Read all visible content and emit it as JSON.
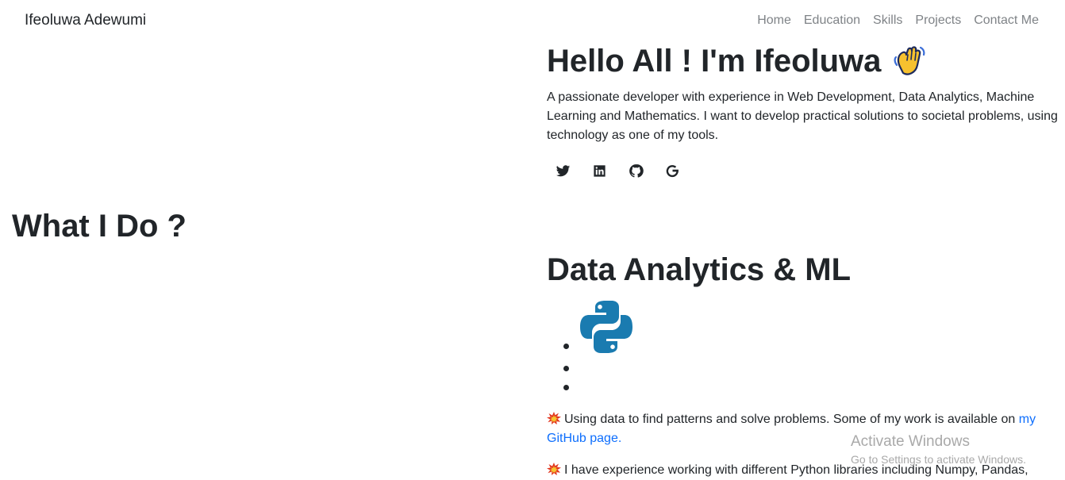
{
  "navbar": {
    "brand": "Ifeoluwa Adewumi",
    "links": [
      "Home",
      "Education",
      "Skills",
      "Projects",
      "Contact Me"
    ]
  },
  "hero": {
    "title": "Hello All ! I'm Ifeoluwa",
    "title_icon": "waving-hand-emoji",
    "description": "A passionate developer with experience in Web Development, Data Analytics, Machine Learning and Mathematics. I want to develop practical solutions to societal problems, using technology as one of my tools.",
    "socials": [
      "twitter-icon",
      "linkedin-icon",
      "github-icon",
      "google-icon"
    ]
  },
  "what_i_do": {
    "title": "What I Do ?"
  },
  "data_analytics": {
    "title": "Data Analytics & ML",
    "skill_icons": [
      "python-icon"
    ],
    "para1_text": "Using data to find patterns and solve problems. Some of my work is available on ",
    "para1_link": "my GitHub page.",
    "para2_text": "I have experience working with different Python libraries including Numpy, Pandas,",
    "bullet_icon": "collision-emoji"
  },
  "watermark": {
    "line1": "Activate Windows",
    "line2": "Go to Settings to activate Windows."
  },
  "colors": {
    "text": "#212529",
    "nav_link": "#7f8387",
    "link": "#0d6efd",
    "python_blue": "#1a7bb0"
  }
}
